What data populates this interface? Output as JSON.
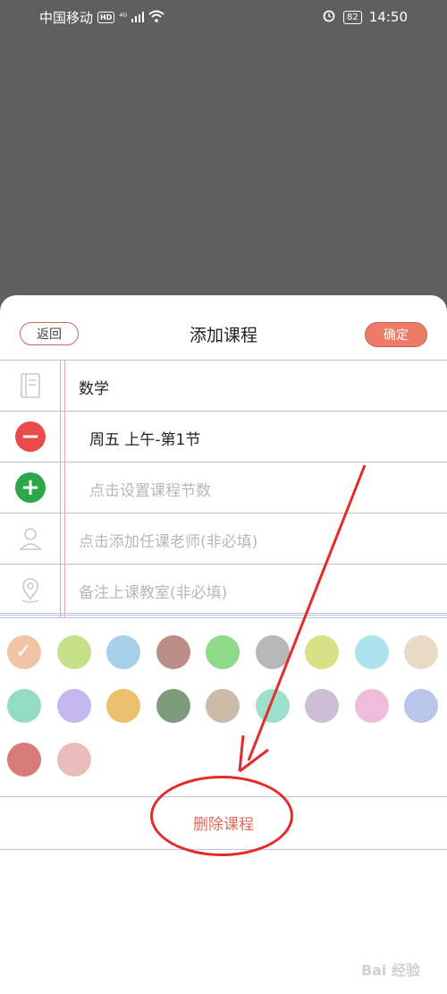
{
  "status_bar": {
    "carrier": "中国移动",
    "hd_badge": "HD",
    "network": "⁴ᴳ",
    "battery": "82",
    "time": "14:50"
  },
  "header": {
    "back_label": "返回",
    "title": "添加课程",
    "confirm_label": "确定"
  },
  "form": {
    "course_name": "数学",
    "schedule": "周五  上午-第1节",
    "add_periods_placeholder": "点击设置课程节数",
    "teacher_placeholder": "点击添加任课老师(非必填)",
    "classroom_placeholder": "备注上课教室(非必填)"
  },
  "palette": {
    "selected_index": 0,
    "colors": [
      "#f0c4a4",
      "#c6e08a",
      "#a8cfe8",
      "#bb8f86",
      "#8ed98a",
      "#b7b7b7",
      "#d8e186",
      "#ace3ec",
      "#e9dac6",
      "#93dcc3",
      "#c5b8f0",
      "#ebc170",
      "#7c9b7a",
      "#ccbba7",
      "#9edecd",
      "#cdbed5",
      "#efbddc",
      "#b9c6e9",
      "#d77a7a",
      "#ebbcbc"
    ]
  },
  "actions": {
    "delete_label": "删除课程"
  },
  "icons": {
    "name_icon": "notebook-icon",
    "remove_icon": "minus-circle-icon",
    "add_icon": "plus-circle-icon",
    "teacher_icon": "person-icon",
    "location_icon": "location-pin-icon"
  },
  "annotation_color": "#e32b2b",
  "watermark": "Bai 经验"
}
